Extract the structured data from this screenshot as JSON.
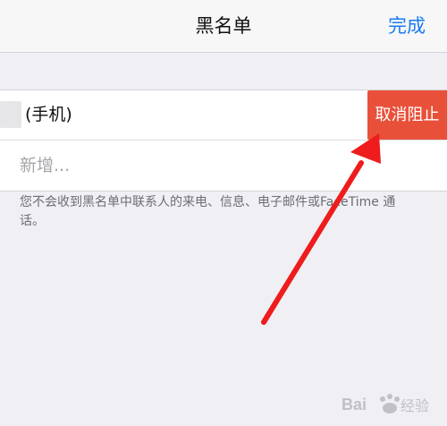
{
  "nav": {
    "title": "黑名单",
    "done_label": "完成"
  },
  "blocked_list": {
    "items": [
      {
        "label": "(手机)",
        "action_label": "取消阻止"
      }
    ],
    "add_new_label": "新增..."
  },
  "footer": {
    "note": "您不会收到黑名单中联系人的来电、信息、电子邮件或FaceTime 通话。"
  },
  "watermark": {
    "text": "Bai 经验"
  },
  "colors": {
    "accent": "#1a7cf2",
    "destructive": "#e9503a",
    "annotation_arrow": "#ee1c1c"
  }
}
